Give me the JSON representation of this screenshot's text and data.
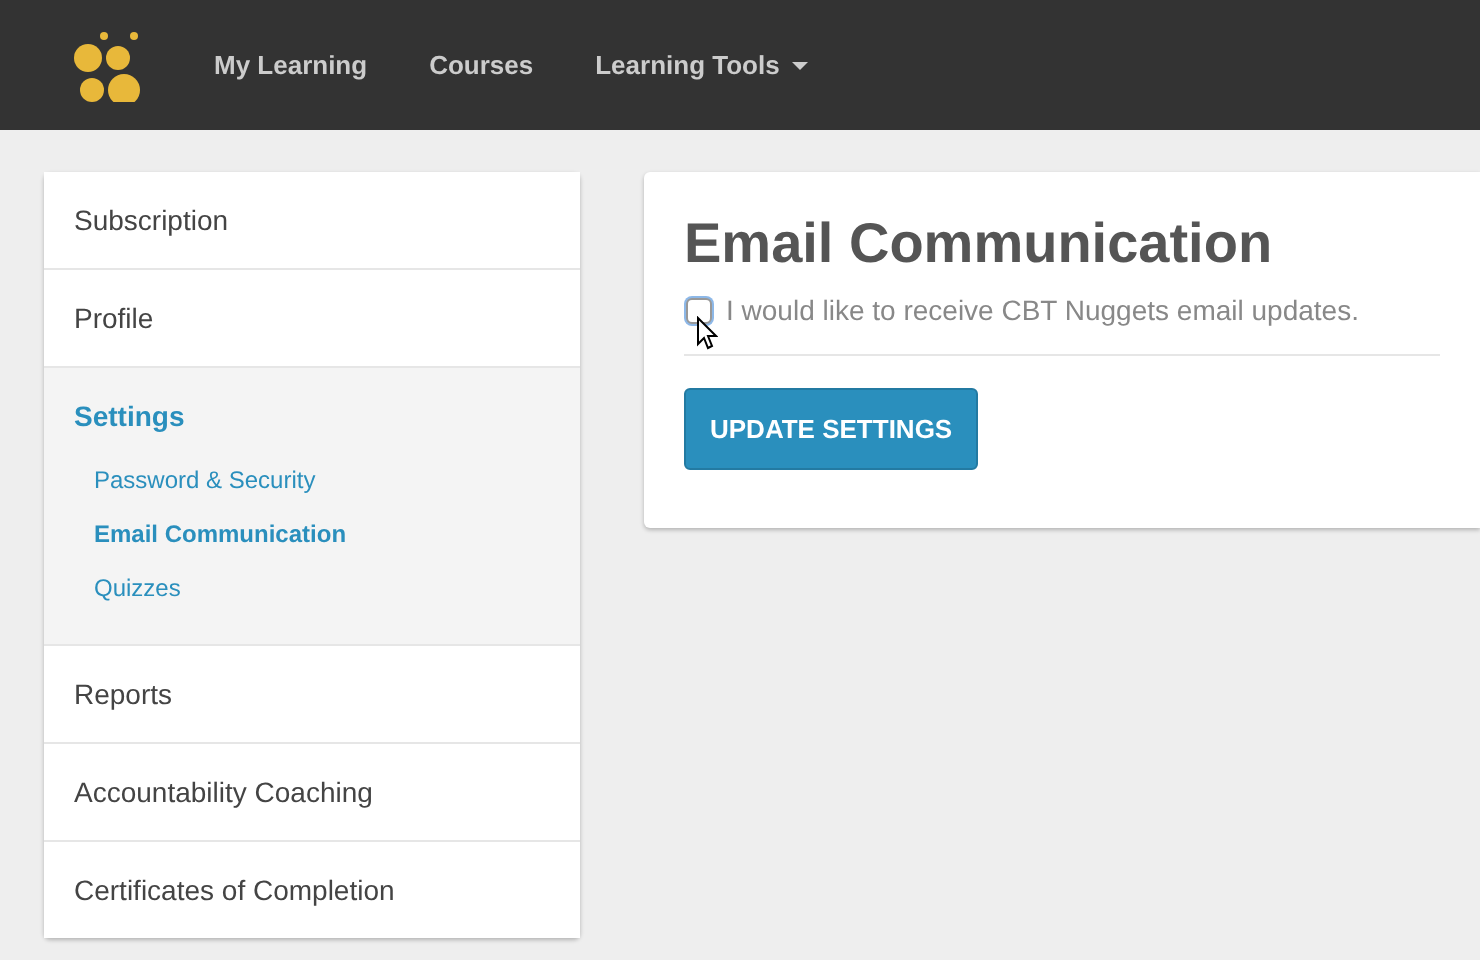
{
  "nav": {
    "items": [
      {
        "label": "My Learning",
        "dropdown": false
      },
      {
        "label": "Courses",
        "dropdown": false
      },
      {
        "label": "Learning Tools",
        "dropdown": true
      }
    ]
  },
  "sidebar": {
    "items": [
      {
        "label": "Subscription",
        "selected": false
      },
      {
        "label": "Profile",
        "selected": false
      },
      {
        "label": "Settings",
        "selected": true,
        "expanded": true,
        "children": [
          {
            "label": "Password & Security",
            "selected": false
          },
          {
            "label": "Email Communication",
            "selected": true
          },
          {
            "label": "Quizzes",
            "selected": false
          }
        ]
      },
      {
        "label": "Reports",
        "selected": false
      },
      {
        "label": "Accountability Coaching",
        "selected": false
      },
      {
        "label": "Certificates of Completion",
        "selected": false
      }
    ]
  },
  "panel": {
    "title": "Email Communication",
    "option": {
      "label": "I would like to receive CBT Nuggets email updates.",
      "checked": false,
      "focused": true
    },
    "button": "UPDATE SETTINGS"
  }
}
